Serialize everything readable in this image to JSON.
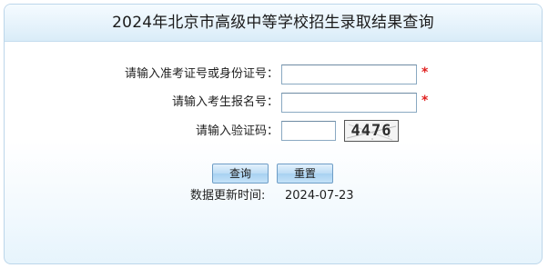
{
  "header": {
    "title": "2024年北京市高级中等学校招生录取结果查询"
  },
  "form": {
    "id_label": "请输入准考证号或身份证号：",
    "id_value": "",
    "name_label": "请输入考生报名号：",
    "name_value": "",
    "captcha_label": "请输入验证码：",
    "captcha_value": "",
    "captcha_image_text": "4476",
    "required_mark": "*"
  },
  "actions": {
    "query_label": "查询",
    "reset_label": "重置"
  },
  "footer": {
    "update_label": "数据更新时间:",
    "update_value": "2024-07-23"
  },
  "colors": {
    "required": "#e0201f",
    "button_gradient_top": "#e3f1fc",
    "button_gradient_bottom": "#a8d1f1",
    "panel_border": "#bcd6ea",
    "title_bar": "#e5f2fb"
  }
}
